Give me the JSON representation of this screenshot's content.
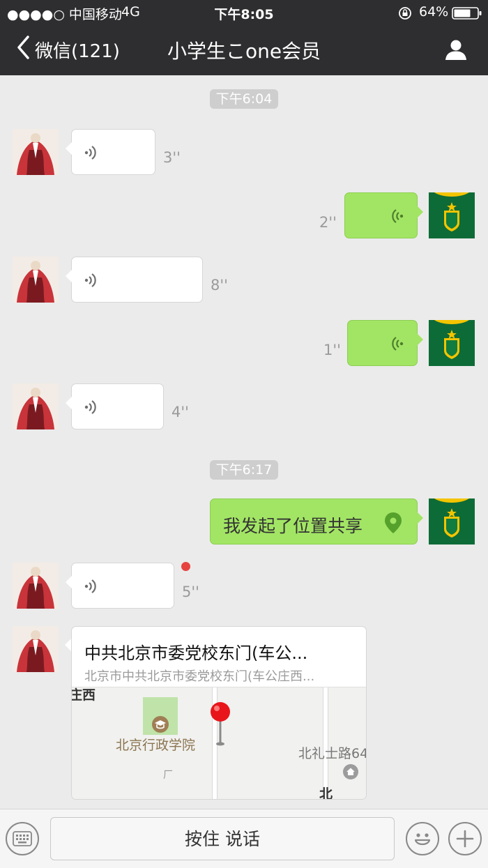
{
  "status_bar": {
    "carrier": "●●●●○ 中国移动",
    "network": "4G",
    "time": "下午8:05",
    "battery": "64%"
  },
  "nav": {
    "back_label": "微信(121)",
    "title": "小学生こone会员"
  },
  "messages": {
    "time1": "下午6:04",
    "voice1": "3''",
    "voice2": "2''",
    "voice3": "8''",
    "voice4": "1''",
    "voice5": "4''",
    "time2": "下午6:17",
    "location_share": "我发起了位置共享",
    "voice6": "5''",
    "location_card": {
      "title": "中共北京市委党校东门(车公...",
      "address": "北京市中共北京市委党校东门(车公庄西...",
      "map_poi": "北京行政学院",
      "map_road": "北礼士路64",
      "map_edge_top": "庄西",
      "map_edge_bottom": "北",
      "map_small": "厂"
    }
  },
  "input_bar": {
    "hold_to_talk": "按住 说话"
  },
  "colors": {
    "nav_bg": "#2e2e30",
    "chat_bg": "#ebebeb",
    "sent_bubble": "#a2e564",
    "received_bubble": "#ffffff",
    "unread_dot": "#e64340"
  },
  "icons": {
    "back": "chevron-left-icon",
    "contact": "person-icon",
    "voice": "voice-wave-icon",
    "location": "location-pin-icon",
    "keyboard": "keyboard-icon",
    "emoji": "emoji-icon",
    "more": "plus-icon"
  }
}
